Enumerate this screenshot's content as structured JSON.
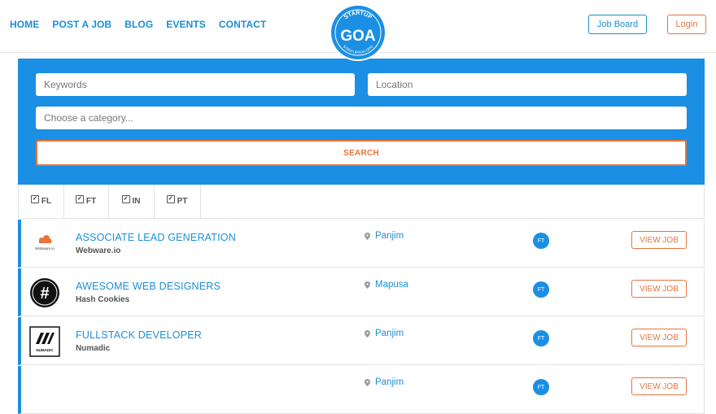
{
  "nav": {
    "items": [
      {
        "label": "HOME"
      },
      {
        "label": "POST A JOB"
      },
      {
        "label": "BLOG"
      },
      {
        "label": "EVENTS"
      },
      {
        "label": "CONTACT"
      }
    ],
    "logo_top_text": "STARTUP",
    "logo_main": "GOA",
    "logo_bottom_text": "STARTUPGOA.ORG",
    "job_board_label": "Job Board",
    "login_label": "Login"
  },
  "search": {
    "keywords_placeholder": "Keywords",
    "location_placeholder": "Location",
    "category_placeholder": "Choose a category...",
    "button_label": "SEARCH"
  },
  "filters": [
    {
      "label": "FL",
      "checked": true
    },
    {
      "label": "FT",
      "checked": true
    },
    {
      "label": "IN",
      "checked": true
    },
    {
      "label": "PT",
      "checked": true
    }
  ],
  "jobs": [
    {
      "title": "ASSOCIATE LEAD GENERATION",
      "company": "Webware.io",
      "location": "Panjim",
      "type": "FT",
      "view_label": "VIEW JOB",
      "logo_text": "Webware.io"
    },
    {
      "title": "AWESOME WEB DESIGNERS",
      "company": "Hash Cookies",
      "location": "Mapusa",
      "type": "FT",
      "view_label": "VIEW JOB",
      "logo_text": "#"
    },
    {
      "title": "FULLSTACK DEVELOPER",
      "company": "Numadic",
      "location": "Panjim",
      "type": "FT",
      "view_label": "VIEW JOB",
      "logo_text": "NUMADIC"
    },
    {
      "title": "",
      "company": "",
      "location": "Panjim",
      "type": "FT",
      "view_label": "VIEW JOB",
      "logo_text": ""
    }
  ],
  "colors": {
    "accent_blue": "#1b8fe3",
    "accent_orange": "#e8743b"
  }
}
